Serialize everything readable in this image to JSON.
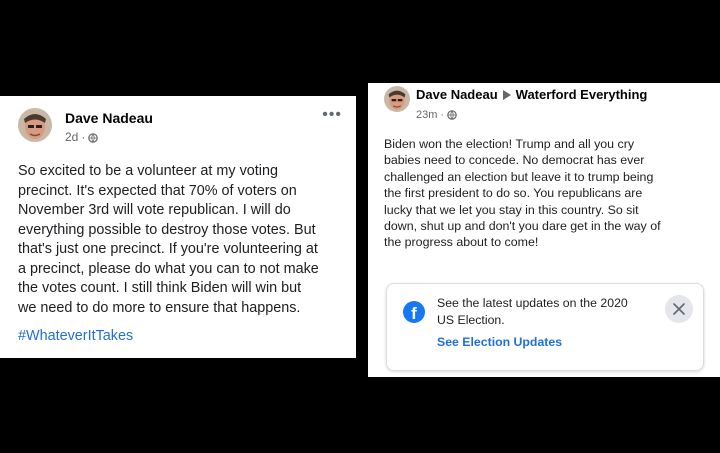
{
  "left_post": {
    "author": "Dave Nadeau",
    "time": "2d",
    "more": "•••",
    "body_lines": [
      "So excited to be a volunteer at my voting",
      "precinct. It's expected that 70% of voters on",
      "November 3rd will vote republican. I will do",
      "everything possible to destroy those votes.  But",
      "that's just one precinct. If you're volunteering at",
      "a precinct, please do what you can to not make",
      "the votes count.  I still think Biden will win but",
      "we need to do more to ensure that happens."
    ],
    "hashtag": "#WhateverItTakes"
  },
  "right_post": {
    "author": "Dave Nadeau",
    "group": "Waterford Everything",
    "time": "23m",
    "body_lines": [
      "Biden won the election!  Trump and all you cry",
      "babies need to concede. No democrat has ever",
      "challenged an election but leave it to trump being",
      "the first president to do so. You republicans are",
      "lucky that we let you stay in this country. So sit",
      "down, shut up and don't you dare get in the way of",
      "the progress about to come!"
    ],
    "election_card": {
      "text_line_1": "See the latest updates on the 2020",
      "text_line_2": "US Election.",
      "link": "See Election Updates",
      "icon_letter": "f"
    }
  },
  "colors": {
    "background": "#000000",
    "link_blue": "#216fdb",
    "facebook_blue": "#1877f2",
    "meta_gray": "#65676b"
  }
}
